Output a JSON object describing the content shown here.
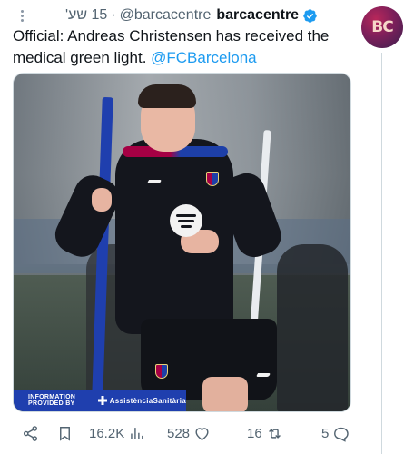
{
  "tweet": {
    "time": "15 שע'",
    "separator": "·",
    "handle": "@barcacentre",
    "display_name": "barcacentre",
    "avatar_text": "BC",
    "text_main": "Official: Andreas Christensen has received the medical green light. ",
    "mention": "@FCBarcelona"
  },
  "media": {
    "info_label": "INFORMATION PROVIDED BY",
    "info_brand": "AssistènciaSanitària"
  },
  "actions": {
    "views": "16.2K",
    "likes": "528",
    "reposts": "16",
    "replies": "5"
  },
  "colors": {
    "accent": "#1d9bf0",
    "muted": "#536471",
    "club_blue": "#1f3fae",
    "club_red": "#a50044"
  },
  "icons": [
    "more-icon",
    "verified-icon",
    "share-icon",
    "bookmark-icon",
    "views-icon",
    "like-icon",
    "repost-icon",
    "reply-icon"
  ]
}
